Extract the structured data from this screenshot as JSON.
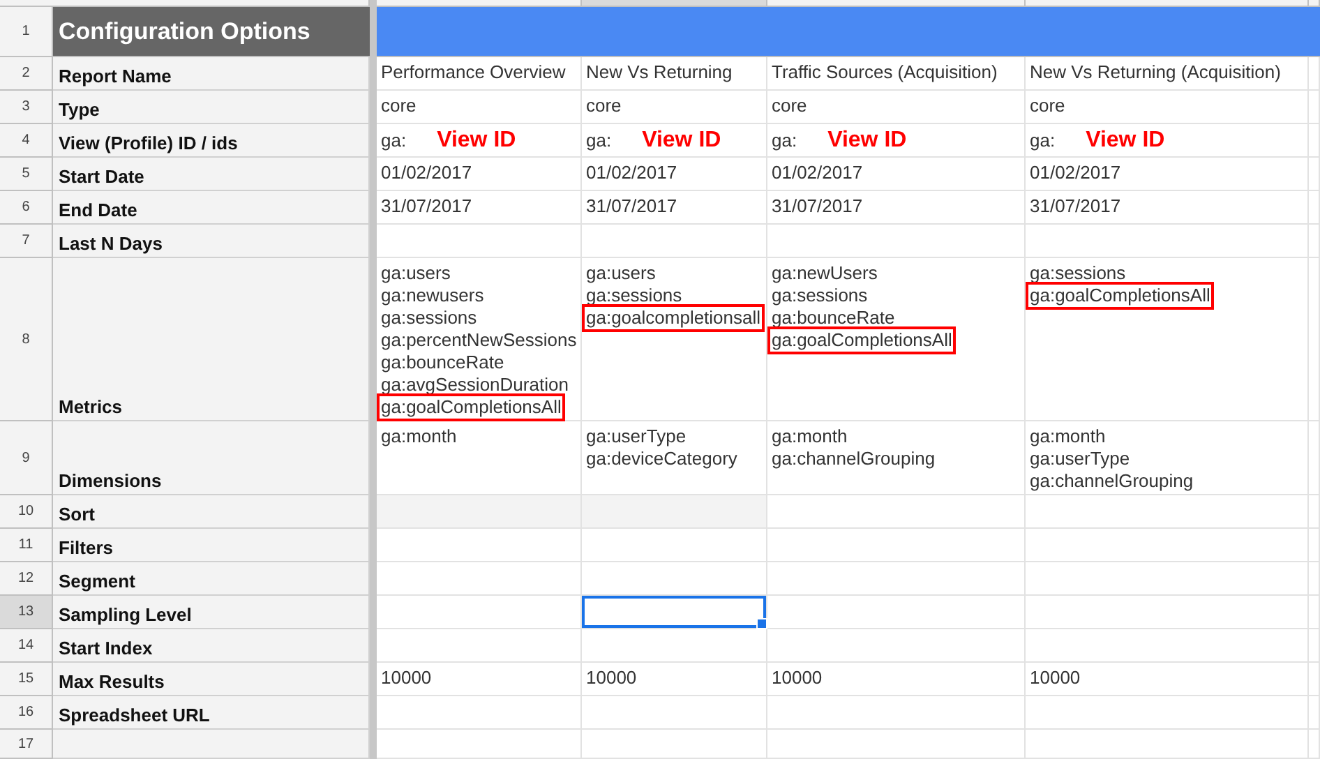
{
  "rows": [
    {
      "number": "1",
      "label": "Configuration Options",
      "kind": "title"
    },
    {
      "number": "2",
      "label": "Report Name",
      "kind": "field",
      "cells": [
        {
          "lines": [
            {
              "text": "Performance Overview",
              "boxed": false
            }
          ],
          "selected": false
        },
        {
          "lines": [
            {
              "text": "New Vs Returning",
              "boxed": false
            }
          ],
          "selected": false
        },
        {
          "lines": [
            {
              "text": "Traffic Sources (Acquisition)",
              "boxed": false
            }
          ],
          "selected": false
        },
        {
          "lines": [
            {
              "text": "New Vs Returning (Acquisition)",
              "boxed": false
            }
          ],
          "selected": false
        }
      ]
    },
    {
      "number": "3",
      "label": "Type",
      "kind": "field",
      "cells": [
        {
          "lines": [
            {
              "text": "core",
              "boxed": false
            }
          ],
          "selected": false
        },
        {
          "lines": [
            {
              "text": "core",
              "boxed": false
            }
          ],
          "selected": false
        },
        {
          "lines": [
            {
              "text": "core",
              "boxed": false
            }
          ],
          "selected": false
        },
        {
          "lines": [
            {
              "text": "core",
              "boxed": false
            }
          ],
          "selected": false
        }
      ]
    },
    {
      "number": "4",
      "label": "View (Profile) ID / ids",
      "kind": "field",
      "cells": [
        {
          "lines": [
            {
              "text": "ga:",
              "boxed": false
            }
          ],
          "note": "View ID",
          "selected": false
        },
        {
          "lines": [
            {
              "text": "ga:",
              "boxed": false
            }
          ],
          "note": "View ID",
          "selected": false
        },
        {
          "lines": [
            {
              "text": "ga:",
              "boxed": false
            }
          ],
          "note": "View ID",
          "selected": false
        },
        {
          "lines": [
            {
              "text": "ga:",
              "boxed": false
            }
          ],
          "note": "View ID",
          "selected": false
        }
      ]
    },
    {
      "number": "5",
      "label": "Start Date",
      "kind": "field",
      "cells": [
        {
          "lines": [
            {
              "text": "01/02/2017",
              "boxed": false
            }
          ],
          "selected": false
        },
        {
          "lines": [
            {
              "text": "01/02/2017",
              "boxed": false
            }
          ],
          "selected": false
        },
        {
          "lines": [
            {
              "text": "01/02/2017",
              "boxed": false
            }
          ],
          "selected": false
        },
        {
          "lines": [
            {
              "text": "01/02/2017",
              "boxed": false
            }
          ],
          "selected": false
        }
      ]
    },
    {
      "number": "6",
      "label": "End Date",
      "kind": "field",
      "cells": [
        {
          "lines": [
            {
              "text": "31/07/2017",
              "boxed": false
            }
          ],
          "selected": false
        },
        {
          "lines": [
            {
              "text": "31/07/2017",
              "boxed": false
            }
          ],
          "selected": false
        },
        {
          "lines": [
            {
              "text": "31/07/2017",
              "boxed": false
            }
          ],
          "selected": false
        },
        {
          "lines": [
            {
              "text": "31/07/2017",
              "boxed": false
            }
          ],
          "selected": false
        }
      ]
    },
    {
      "number": "7",
      "label": "Last N Days",
      "kind": "field",
      "cells": [
        {
          "selected": false
        },
        {
          "selected": false
        },
        {
          "selected": false
        },
        {
          "selected": false
        }
      ]
    },
    {
      "number": "8",
      "label": "Metrics",
      "kind": "field",
      "cells": [
        {
          "lines": [
            {
              "text": "ga:users",
              "boxed": false
            },
            {
              "text": "ga:newusers",
              "boxed": false
            },
            {
              "text": "ga:sessions",
              "boxed": false
            },
            {
              "text": "ga:percentNewSessions",
              "boxed": false
            },
            {
              "text": "ga:bounceRate",
              "boxed": false
            },
            {
              "text": "ga:avgSessionDuration",
              "boxed": false
            },
            {
              "text": "ga:goalCompletionsAll",
              "boxed": true
            }
          ],
          "selected": false
        },
        {
          "lines": [
            {
              "text": "ga:users",
              "boxed": false
            },
            {
              "text": "ga:sessions",
              "boxed": false
            },
            {
              "text": "ga:goalcompletionsall",
              "boxed": true
            }
          ],
          "selected": false
        },
        {
          "lines": [
            {
              "text": "ga:newUsers",
              "boxed": false
            },
            {
              "text": "ga:sessions",
              "boxed": false
            },
            {
              "text": "ga:bounceRate",
              "boxed": false
            },
            {
              "text": "ga:goalCompletionsAll",
              "boxed": true
            }
          ],
          "selected": false
        },
        {
          "lines": [
            {
              "text": "ga:sessions",
              "boxed": false
            },
            {
              "text": "ga:goalCompletionsAll",
              "boxed": true
            }
          ],
          "selected": false
        }
      ]
    },
    {
      "number": "9",
      "label": "Dimensions",
      "kind": "field",
      "cells": [
        {
          "lines": [
            {
              "text": "ga:month",
              "boxed": false
            }
          ],
          "selected": false
        },
        {
          "lines": [
            {
              "text": "ga:userType",
              "boxed": false
            },
            {
              "text": "ga:deviceCategory",
              "boxed": false
            }
          ],
          "selected": false
        },
        {
          "lines": [
            {
              "text": "ga:month",
              "boxed": false
            },
            {
              "text": "ga:channelGrouping",
              "boxed": false
            }
          ],
          "selected": false
        },
        {
          "lines": [
            {
              "text": "ga:month",
              "boxed": false
            },
            {
              "text": "ga:userType",
              "boxed": false
            },
            {
              "text": "ga:channelGrouping",
              "boxed": false
            }
          ],
          "selected": false
        }
      ]
    },
    {
      "number": "10",
      "label": "Sort",
      "kind": "field",
      "cells": [
        {
          "selected": false
        },
        {
          "selected": false
        },
        {
          "selected": false
        },
        {
          "selected": false
        }
      ]
    },
    {
      "number": "11",
      "label": "Filters",
      "kind": "field",
      "cells": [
        {
          "selected": false
        },
        {
          "selected": false
        },
        {
          "selected": false
        },
        {
          "selected": false
        }
      ]
    },
    {
      "number": "12",
      "label": "Segment",
      "kind": "field",
      "cells": [
        {
          "selected": false
        },
        {
          "selected": false
        },
        {
          "selected": false
        },
        {
          "selected": false
        }
      ]
    },
    {
      "number": "13",
      "label": "Sampling Level",
      "kind": "field",
      "cells": [
        {
          "selected": false
        },
        {
          "selected": true
        },
        {
          "selected": false
        },
        {
          "selected": false
        }
      ]
    },
    {
      "number": "14",
      "label": "Start Index",
      "kind": "field",
      "cells": [
        {
          "selected": false
        },
        {
          "selected": false
        },
        {
          "selected": false
        },
        {
          "selected": false
        }
      ]
    },
    {
      "number": "15",
      "label": "Max Results",
      "kind": "field",
      "cells": [
        {
          "lines": [
            {
              "text": "10000",
              "boxed": false
            }
          ],
          "selected": false
        },
        {
          "lines": [
            {
              "text": "10000",
              "boxed": false
            }
          ],
          "selected": false
        },
        {
          "lines": [
            {
              "text": "10000",
              "boxed": false
            }
          ],
          "selected": false
        },
        {
          "lines": [
            {
              "text": "10000",
              "boxed": false
            }
          ],
          "selected": false
        }
      ]
    },
    {
      "number": "16",
      "label": "Spreadsheet URL",
      "kind": "field",
      "cells": [
        {
          "selected": false
        },
        {
          "selected": false
        },
        {
          "selected": false
        },
        {
          "selected": false
        }
      ]
    },
    {
      "number": "17",
      "kind": "field"
    }
  ]
}
